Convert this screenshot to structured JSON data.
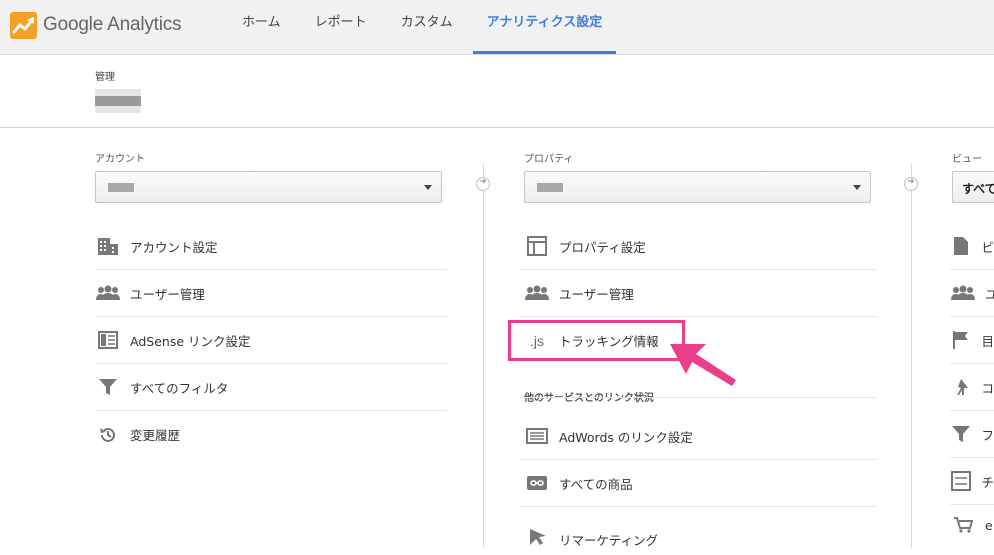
{
  "brand": {
    "name_main": "Google",
    "name_sub": "Analytics"
  },
  "nav": [
    {
      "label": "ホーム",
      "active": false
    },
    {
      "label": "レポート",
      "active": false
    },
    {
      "label": "カスタム",
      "active": false
    },
    {
      "label": "アナリティクス設定",
      "active": true
    }
  ],
  "admin": {
    "label": "管理"
  },
  "account_col": {
    "label": "アカウント",
    "items": [
      {
        "label": "アカウント設定",
        "icon": "building-icon"
      },
      {
        "label": "ユーザー管理",
        "icon": "users-icon"
      },
      {
        "label": "AdSense リンク設定",
        "icon": "adsense-icon"
      },
      {
        "label": "すべてのフィルタ",
        "icon": "filter-icon"
      },
      {
        "label": "変更履歴",
        "icon": "history-icon"
      }
    ]
  },
  "property_col": {
    "label": "プロパティ",
    "items": [
      {
        "label": "プロパティ設定",
        "icon": "window-icon"
      },
      {
        "label": "ユーザー管理",
        "icon": "users-icon"
      },
      {
        "label": "トラッキング情報",
        "icon": "js-icon",
        "icon_text": ".js"
      }
    ],
    "section_label": "他のサービスとのリンク状況",
    "linked": [
      {
        "label": "AdWords のリンク設定",
        "icon": "adwords-icon"
      },
      {
        "label": "すべての商品",
        "icon": "link-icon"
      },
      {
        "label": "リマーケティング",
        "icon": "remarketing-icon"
      }
    ]
  },
  "view_col": {
    "label": "ビュー",
    "selected": "すべて",
    "item_initials": [
      "ビ",
      "ユ",
      "目",
      "コ",
      "フ",
      "チ",
      "e"
    ]
  },
  "colors": {
    "accent": "#3d7ee3",
    "highlight": "#ea3e8b"
  }
}
